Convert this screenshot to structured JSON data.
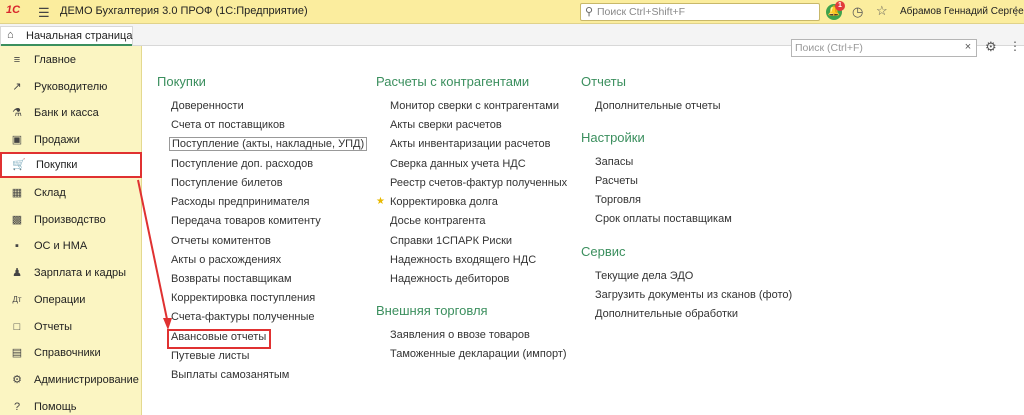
{
  "titlebar": {
    "logo": "1С",
    "app_title": "ДЕМО Бухгалтерия 3.0 ПРОФ  (1С:Предприятие)",
    "search_placeholder": "Поиск Ctrl+Shift+F",
    "notification_count": "1",
    "user_name": "Абрамов Геннадий Сергеевич"
  },
  "tabs": {
    "home_label": "Начальная страница"
  },
  "sidebar": {
    "items": [
      {
        "label": "Главное",
        "icon": "menu-icon"
      },
      {
        "label": "Руководителю",
        "icon": "trend-icon"
      },
      {
        "label": "Банк и касса",
        "icon": "bank-icon"
      },
      {
        "label": "Продажи",
        "icon": "briefcase-icon"
      },
      {
        "label": "Покупки",
        "icon": "cart-icon"
      },
      {
        "label": "Склад",
        "icon": "warehouse-icon"
      },
      {
        "label": "Производство",
        "icon": "factory-icon"
      },
      {
        "label": "ОС и НМА",
        "icon": "truck-icon"
      },
      {
        "label": "Зарплата и кадры",
        "icon": "people-icon"
      },
      {
        "label": "Операции",
        "icon": "operations-icon"
      },
      {
        "label": "Отчеты",
        "icon": "chart-icon"
      },
      {
        "label": "Справочники",
        "icon": "book-icon"
      },
      {
        "label": "Администрирование",
        "icon": "gear-icon"
      },
      {
        "label": "Помощь",
        "icon": "help-icon"
      }
    ],
    "active_index": 4
  },
  "content": {
    "search_placeholder": "Поиск (Ctrl+F)",
    "purchases": {
      "title": "Покупки",
      "links": [
        "Доверенности",
        "Счета от поставщиков",
        "Поступление (акты, накладные, УПД)",
        "Поступление доп. расходов",
        "Поступление билетов",
        "Расходы предпринимателя",
        "Передача товаров комитенту",
        "Отчеты комитентов",
        "Акты о расхождениях",
        "Возвраты поставщикам",
        "Корректировка поступления",
        "Счета-фактуры полученные",
        "Авансовые отчеты",
        "Путевые листы",
        "Выплаты самозанятым"
      ]
    },
    "counterparties": {
      "title": "Расчеты с контрагентами",
      "links": [
        "Монитор сверки с контрагентами",
        "Акты сверки расчетов",
        "Акты инвентаризации расчетов",
        "Сверка данных учета НДС",
        "Реестр счетов-фактур полученных",
        "Корректировка долга",
        "Досье контрагента",
        "Справки 1СПАРК Риски",
        "Надежность входящего НДС",
        "Надежность дебиторов"
      ]
    },
    "foreign_trade": {
      "title": "Внешняя торговля",
      "links": [
        "Заявления о ввозе товаров",
        "Таможенные декларации (импорт)"
      ]
    },
    "reports": {
      "title": "Отчеты",
      "links": [
        "Дополнительные отчеты"
      ]
    },
    "settings": {
      "title": "Настройки",
      "links": [
        "Запасы",
        "Расчеты",
        "Торговля",
        "Срок оплаты поставщикам"
      ]
    },
    "service": {
      "title": "Сервис",
      "links": [
        "Текущие дела ЭДО",
        "Загрузить документы из сканов (фото)",
        "Дополнительные обработки"
      ]
    }
  },
  "colors": {
    "accent_green": "#3b8f5e",
    "highlight_red": "#e03131",
    "sidebar_bg": "#fbf5c2",
    "titlebar_bg": "#fbed9e"
  }
}
